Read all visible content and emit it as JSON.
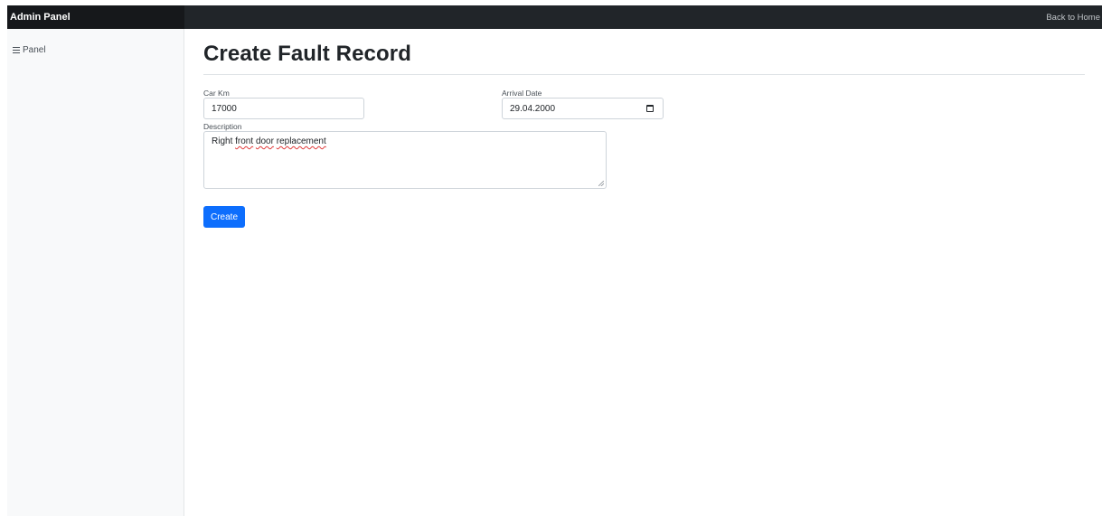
{
  "navbar": {
    "brand": "Admin Panel",
    "back_link": "Back to Home"
  },
  "sidebar": {
    "items": [
      {
        "label": "Panel",
        "icon": "menu-icon"
      }
    ]
  },
  "page": {
    "title": "Create Fault Record"
  },
  "form": {
    "car_km": {
      "label": "Car Km",
      "value": "17000"
    },
    "arrival_date": {
      "label": "Arrival Date",
      "value": "29.04.2000",
      "icon": "calendar-icon"
    },
    "description": {
      "label": "Description",
      "words": [
        "Right",
        "front",
        "door",
        "replacement"
      ]
    },
    "submit_label": "Create"
  },
  "colors": {
    "navbar_bg": "#212529",
    "sidebar_bg": "#f8f9fa",
    "primary": "#0d6efd"
  }
}
